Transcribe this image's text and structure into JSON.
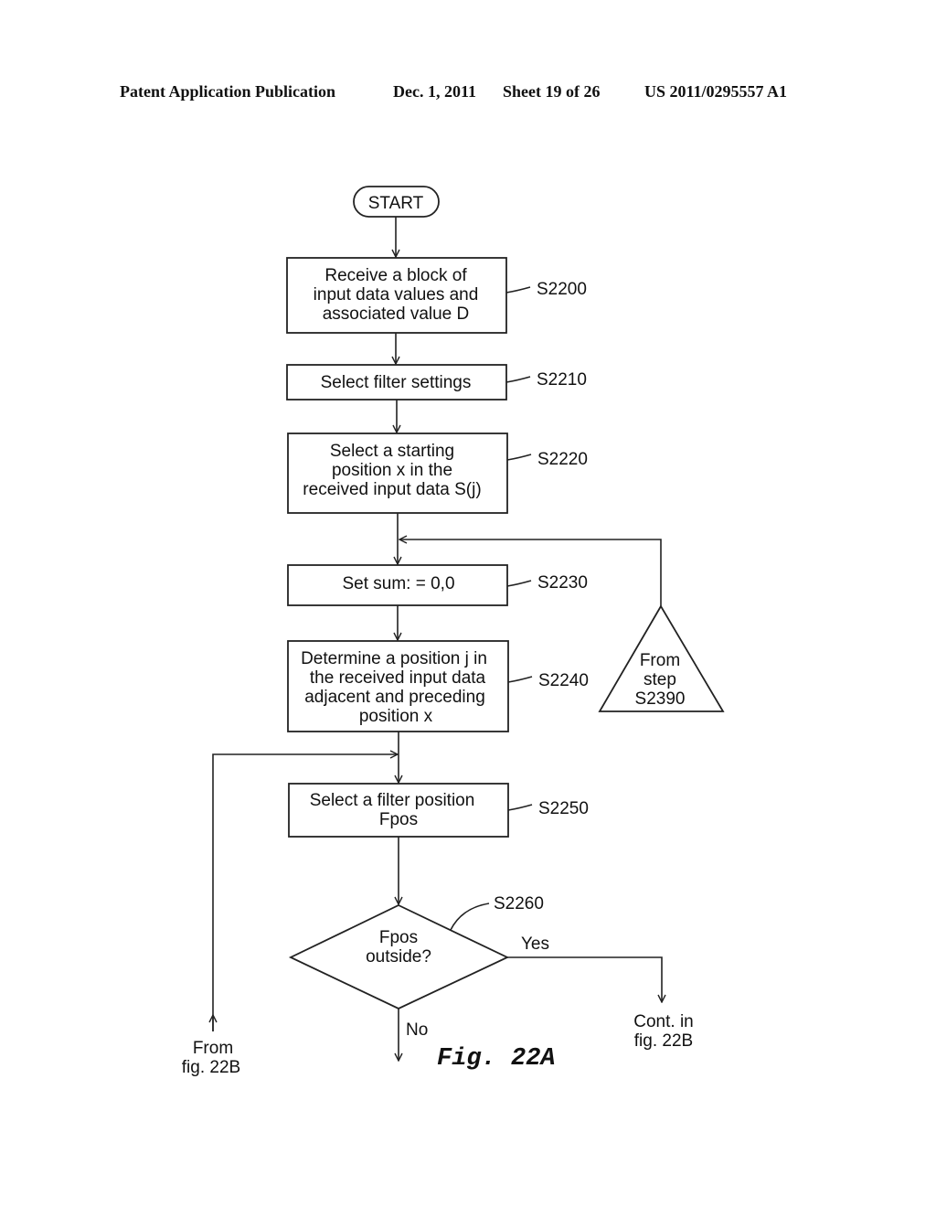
{
  "header": {
    "publication": "Patent Application Publication",
    "date": "Dec. 1, 2011",
    "sheet": "Sheet 19 of 26",
    "number": "US 2011/0295557 A1"
  },
  "flowchart": {
    "start": "START",
    "steps": [
      {
        "id": "S2200",
        "lines": [
          "Receive a block of",
          "input data values and",
          "associated value D"
        ]
      },
      {
        "id": "S2210",
        "lines": [
          "Select filter settings"
        ]
      },
      {
        "id": "S2220",
        "lines": [
          "Select a starting",
          "position x in the",
          "received input data S(j)"
        ]
      },
      {
        "id": "S2230",
        "lines": [
          "Set sum: = 0,0"
        ]
      },
      {
        "id": "S2240",
        "lines": [
          "Determine a position j in",
          "the received input data",
          "adjacent and preceding",
          "position x"
        ]
      },
      {
        "id": "S2250",
        "lines": [
          "Select a filter position",
          "Fpos"
        ]
      }
    ],
    "decision": {
      "id": "S2260",
      "lines": [
        "Fpos",
        "outside?"
      ],
      "yes": "Yes",
      "no": "No"
    },
    "connector": {
      "lines": [
        "From",
        "step",
        "S2390"
      ]
    },
    "from_ref": [
      "From",
      "fig. 22B"
    ],
    "cont_ref": [
      "Cont. in",
      "fig. 22B"
    ],
    "figure_label": "Fig. 22A"
  }
}
